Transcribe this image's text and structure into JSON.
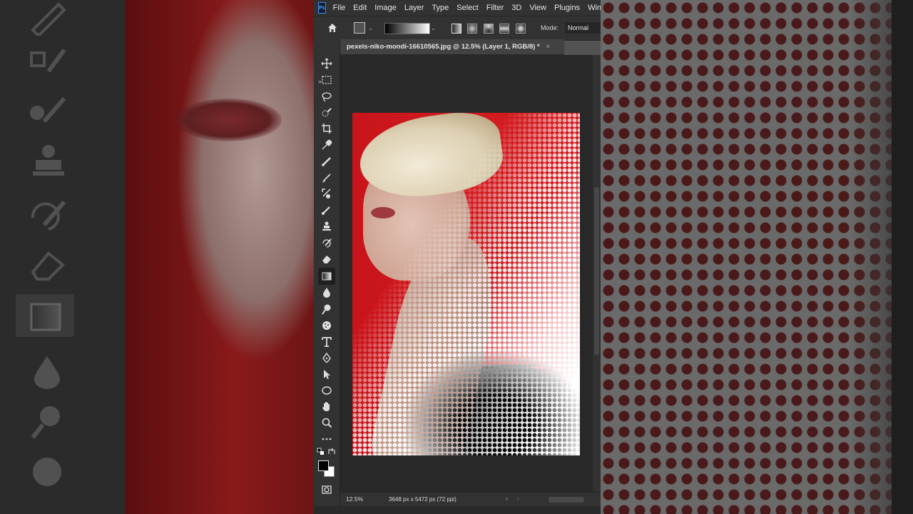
{
  "app": {
    "logo_text": "Ps",
    "menu": [
      "File",
      "Edit",
      "Image",
      "Layer",
      "Type",
      "Select",
      "Filter",
      "3D",
      "View",
      "Plugins",
      "Window"
    ]
  },
  "options_bar": {
    "mode_label": "Mode:",
    "mode_value": "Normal",
    "gradient": "black-to-white"
  },
  "document": {
    "tab_title": "pexels-niko-mondi-16610565.jpg @ 12.5% (Layer 1, RGB/8) *",
    "close_glyph": "×"
  },
  "status": {
    "zoom": "12.5%",
    "doc_size": "3648 px x 5472 px (72 ppi)",
    "arrow": "›",
    "scroll_left": "‹",
    "scroll_right": "›"
  },
  "toolbar": {
    "collapse": "»",
    "tools": [
      "move-tool",
      "marquee-tool",
      "lasso-tool",
      "quick-selection-tool",
      "crop-tool",
      "eyedropper-tool",
      "healing-brush-tool",
      "brush-tool",
      "clone-stamp-tool",
      "history-brush-tool",
      "eraser-tool",
      "gradient-tool",
      "blur-tool",
      "dodge-tool",
      "sponge-tool",
      "type-tool",
      "pen-tool",
      "path-selection-tool",
      "ellipse-tool",
      "hand-tool",
      "zoom-tool",
      "more-tools"
    ],
    "active_tool": "gradient-tool"
  },
  "colors": {
    "foreground": "#000000",
    "background": "#ffffff",
    "accent": "#3d8df0"
  }
}
